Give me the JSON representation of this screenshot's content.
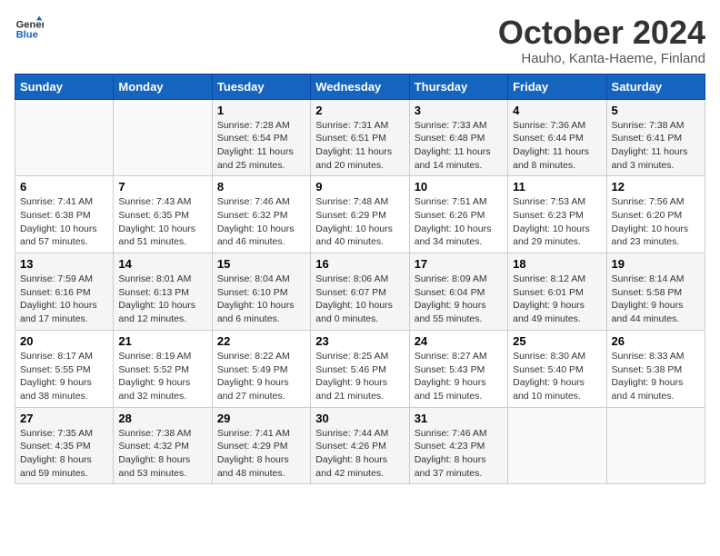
{
  "header": {
    "logo_line1": "General",
    "logo_line2": "Blue",
    "month": "October 2024",
    "location": "Hauho, Kanta-Haeme, Finland"
  },
  "days_of_week": [
    "Sunday",
    "Monday",
    "Tuesday",
    "Wednesday",
    "Thursday",
    "Friday",
    "Saturday"
  ],
  "weeks": [
    [
      {
        "day": "",
        "info": ""
      },
      {
        "day": "",
        "info": ""
      },
      {
        "day": "1",
        "info": "Sunrise: 7:28 AM\nSunset: 6:54 PM\nDaylight: 11 hours\nand 25 minutes."
      },
      {
        "day": "2",
        "info": "Sunrise: 7:31 AM\nSunset: 6:51 PM\nDaylight: 11 hours\nand 20 minutes."
      },
      {
        "day": "3",
        "info": "Sunrise: 7:33 AM\nSunset: 6:48 PM\nDaylight: 11 hours\nand 14 minutes."
      },
      {
        "day": "4",
        "info": "Sunrise: 7:36 AM\nSunset: 6:44 PM\nDaylight: 11 hours\nand 8 minutes."
      },
      {
        "day": "5",
        "info": "Sunrise: 7:38 AM\nSunset: 6:41 PM\nDaylight: 11 hours\nand 3 minutes."
      }
    ],
    [
      {
        "day": "6",
        "info": "Sunrise: 7:41 AM\nSunset: 6:38 PM\nDaylight: 10 hours\nand 57 minutes."
      },
      {
        "day": "7",
        "info": "Sunrise: 7:43 AM\nSunset: 6:35 PM\nDaylight: 10 hours\nand 51 minutes."
      },
      {
        "day": "8",
        "info": "Sunrise: 7:46 AM\nSunset: 6:32 PM\nDaylight: 10 hours\nand 46 minutes."
      },
      {
        "day": "9",
        "info": "Sunrise: 7:48 AM\nSunset: 6:29 PM\nDaylight: 10 hours\nand 40 minutes."
      },
      {
        "day": "10",
        "info": "Sunrise: 7:51 AM\nSunset: 6:26 PM\nDaylight: 10 hours\nand 34 minutes."
      },
      {
        "day": "11",
        "info": "Sunrise: 7:53 AM\nSunset: 6:23 PM\nDaylight: 10 hours\nand 29 minutes."
      },
      {
        "day": "12",
        "info": "Sunrise: 7:56 AM\nSunset: 6:20 PM\nDaylight: 10 hours\nand 23 minutes."
      }
    ],
    [
      {
        "day": "13",
        "info": "Sunrise: 7:59 AM\nSunset: 6:16 PM\nDaylight: 10 hours\nand 17 minutes."
      },
      {
        "day": "14",
        "info": "Sunrise: 8:01 AM\nSunset: 6:13 PM\nDaylight: 10 hours\nand 12 minutes."
      },
      {
        "day": "15",
        "info": "Sunrise: 8:04 AM\nSunset: 6:10 PM\nDaylight: 10 hours\nand 6 minutes."
      },
      {
        "day": "16",
        "info": "Sunrise: 8:06 AM\nSunset: 6:07 PM\nDaylight: 10 hours\nand 0 minutes."
      },
      {
        "day": "17",
        "info": "Sunrise: 8:09 AM\nSunset: 6:04 PM\nDaylight: 9 hours\nand 55 minutes."
      },
      {
        "day": "18",
        "info": "Sunrise: 8:12 AM\nSunset: 6:01 PM\nDaylight: 9 hours\nand 49 minutes."
      },
      {
        "day": "19",
        "info": "Sunrise: 8:14 AM\nSunset: 5:58 PM\nDaylight: 9 hours\nand 44 minutes."
      }
    ],
    [
      {
        "day": "20",
        "info": "Sunrise: 8:17 AM\nSunset: 5:55 PM\nDaylight: 9 hours\nand 38 minutes."
      },
      {
        "day": "21",
        "info": "Sunrise: 8:19 AM\nSunset: 5:52 PM\nDaylight: 9 hours\nand 32 minutes."
      },
      {
        "day": "22",
        "info": "Sunrise: 8:22 AM\nSunset: 5:49 PM\nDaylight: 9 hours\nand 27 minutes."
      },
      {
        "day": "23",
        "info": "Sunrise: 8:25 AM\nSunset: 5:46 PM\nDaylight: 9 hours\nand 21 minutes."
      },
      {
        "day": "24",
        "info": "Sunrise: 8:27 AM\nSunset: 5:43 PM\nDaylight: 9 hours\nand 15 minutes."
      },
      {
        "day": "25",
        "info": "Sunrise: 8:30 AM\nSunset: 5:40 PM\nDaylight: 9 hours\nand 10 minutes."
      },
      {
        "day": "26",
        "info": "Sunrise: 8:33 AM\nSunset: 5:38 PM\nDaylight: 9 hours\nand 4 minutes."
      }
    ],
    [
      {
        "day": "27",
        "info": "Sunrise: 7:35 AM\nSunset: 4:35 PM\nDaylight: 8 hours\nand 59 minutes."
      },
      {
        "day": "28",
        "info": "Sunrise: 7:38 AM\nSunset: 4:32 PM\nDaylight: 8 hours\nand 53 minutes."
      },
      {
        "day": "29",
        "info": "Sunrise: 7:41 AM\nSunset: 4:29 PM\nDaylight: 8 hours\nand 48 minutes."
      },
      {
        "day": "30",
        "info": "Sunrise: 7:44 AM\nSunset: 4:26 PM\nDaylight: 8 hours\nand 42 minutes."
      },
      {
        "day": "31",
        "info": "Sunrise: 7:46 AM\nSunset: 4:23 PM\nDaylight: 8 hours\nand 37 minutes."
      },
      {
        "day": "",
        "info": ""
      },
      {
        "day": "",
        "info": ""
      }
    ]
  ]
}
